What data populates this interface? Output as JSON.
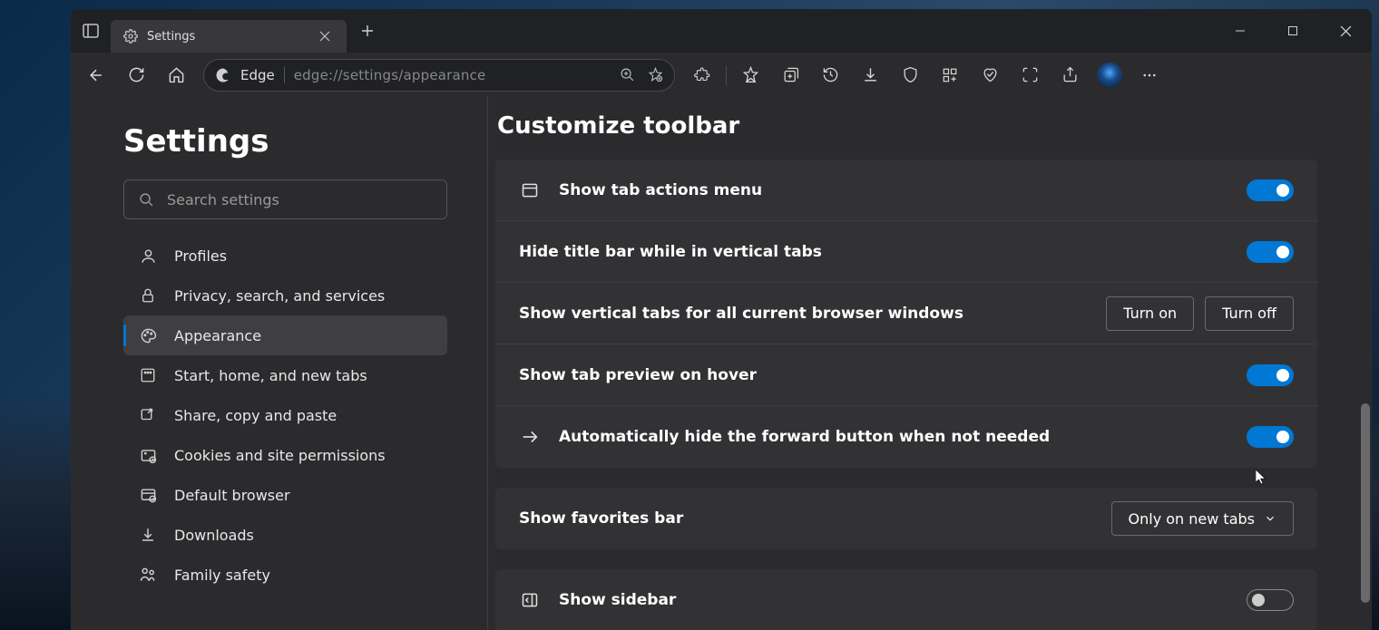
{
  "tab": {
    "title": "Settings"
  },
  "addressbar": {
    "label": "Edge",
    "url": "edge://settings/appearance"
  },
  "sidebar": {
    "title": "Settings",
    "search_placeholder": "Search settings",
    "items": [
      {
        "label": "Profiles"
      },
      {
        "label": "Privacy, search, and services"
      },
      {
        "label": "Appearance"
      },
      {
        "label": "Start, home, and new tabs"
      },
      {
        "label": "Share, copy and paste"
      },
      {
        "label": "Cookies and site permissions"
      },
      {
        "label": "Default browser"
      },
      {
        "label": "Downloads"
      },
      {
        "label": "Family safety"
      }
    ]
  },
  "main": {
    "heading": "Customize toolbar",
    "toolbar_rows": [
      {
        "label": "Show tab actions menu",
        "kind": "toggle",
        "value": true,
        "icon": "panel"
      },
      {
        "label": "Hide title bar while in vertical tabs",
        "kind": "toggle",
        "value": true
      },
      {
        "label": "Show vertical tabs for all current browser windows",
        "kind": "buttons",
        "on_label": "Turn on",
        "off_label": "Turn off"
      },
      {
        "label": "Show tab preview on hover",
        "kind": "toggle",
        "value": true
      },
      {
        "label": "Automatically hide the forward button when not needed",
        "kind": "toggle",
        "value": true,
        "icon": "arrow"
      }
    ],
    "favorites_row": {
      "label": "Show favorites bar",
      "value": "Only on new tabs"
    },
    "sidebar_row": {
      "label": "Show sidebar",
      "value": false,
      "icon": "sidebar"
    }
  }
}
